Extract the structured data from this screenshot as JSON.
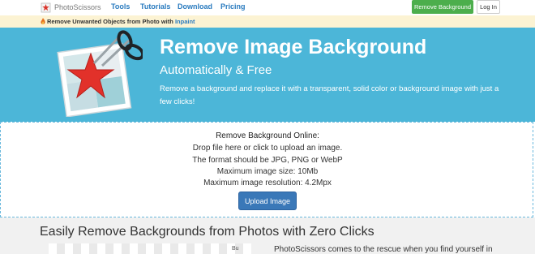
{
  "nav": {
    "logo_text": "PhotoScissors",
    "links": [
      "Tools",
      "Tutorials",
      "Download",
      "Pricing"
    ],
    "remove_background_button": "Remove Background",
    "login_button": "Log In"
  },
  "promo": {
    "text": "Remove Unwanted Objects from Photo with",
    "link": "Inpaint"
  },
  "hero": {
    "title": "Remove Image Background",
    "subtitle": "Automatically & Free",
    "description": "Remove a background and replace it with a transparent, solid color or background image with just a few clicks!"
  },
  "upload": {
    "title": "Remove Background Online:",
    "lines": [
      "Drop file here or click to upload an image.",
      "The format should be JPG, PNG or WebP",
      "Maximum image size: 10Mb",
      "Maximum image resolution: 4.2Mpx"
    ],
    "button": "Upload Image"
  },
  "section": {
    "title": "Easily Remove Backgrounds from Photos with Zero Clicks",
    "text": "PhotoScissors comes to the rescue when you find yourself in",
    "thumb_label": "Bu"
  },
  "colors": {
    "hero_bg": "#4cb6d8",
    "accent_green": "#4cae4c",
    "upload_blue": "#3a78b8",
    "promo_bg": "#fcf3d3"
  }
}
